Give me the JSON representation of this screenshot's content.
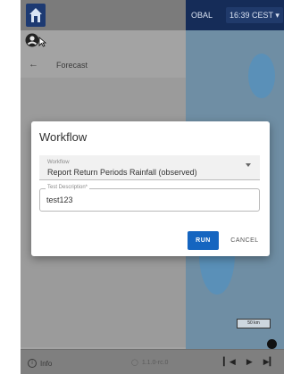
{
  "header": {
    "region_label": "OBAL",
    "time": "16:39 CEST"
  },
  "panel": {
    "title": "Forecast"
  },
  "dialog": {
    "title": "Workflow",
    "workflow_label": "Workflow",
    "workflow_value": "Report Return Periods Rainfall (observed)",
    "description_label": "Test Description*",
    "description_value": "test123",
    "run_label": "RUN",
    "cancel_label": "CANCEL"
  },
  "footer": {
    "info_label": "Info",
    "version": "1.1.0-rc.0"
  },
  "map": {
    "scale_label": "50 km"
  },
  "icons": {
    "logo": "house-logo-icon",
    "account": "account-circle-icon",
    "back": "arrow-left-icon",
    "time_dropdown": "chevron-down-icon",
    "info": "info-icon",
    "version": "tag-icon",
    "prev": "skip-previous-icon",
    "play": "play-icon",
    "next": "skip-next-icon"
  },
  "colors": {
    "primary": "#1565c0",
    "header_bg": "#152c58",
    "logo_bg": "#1d3a72"
  }
}
